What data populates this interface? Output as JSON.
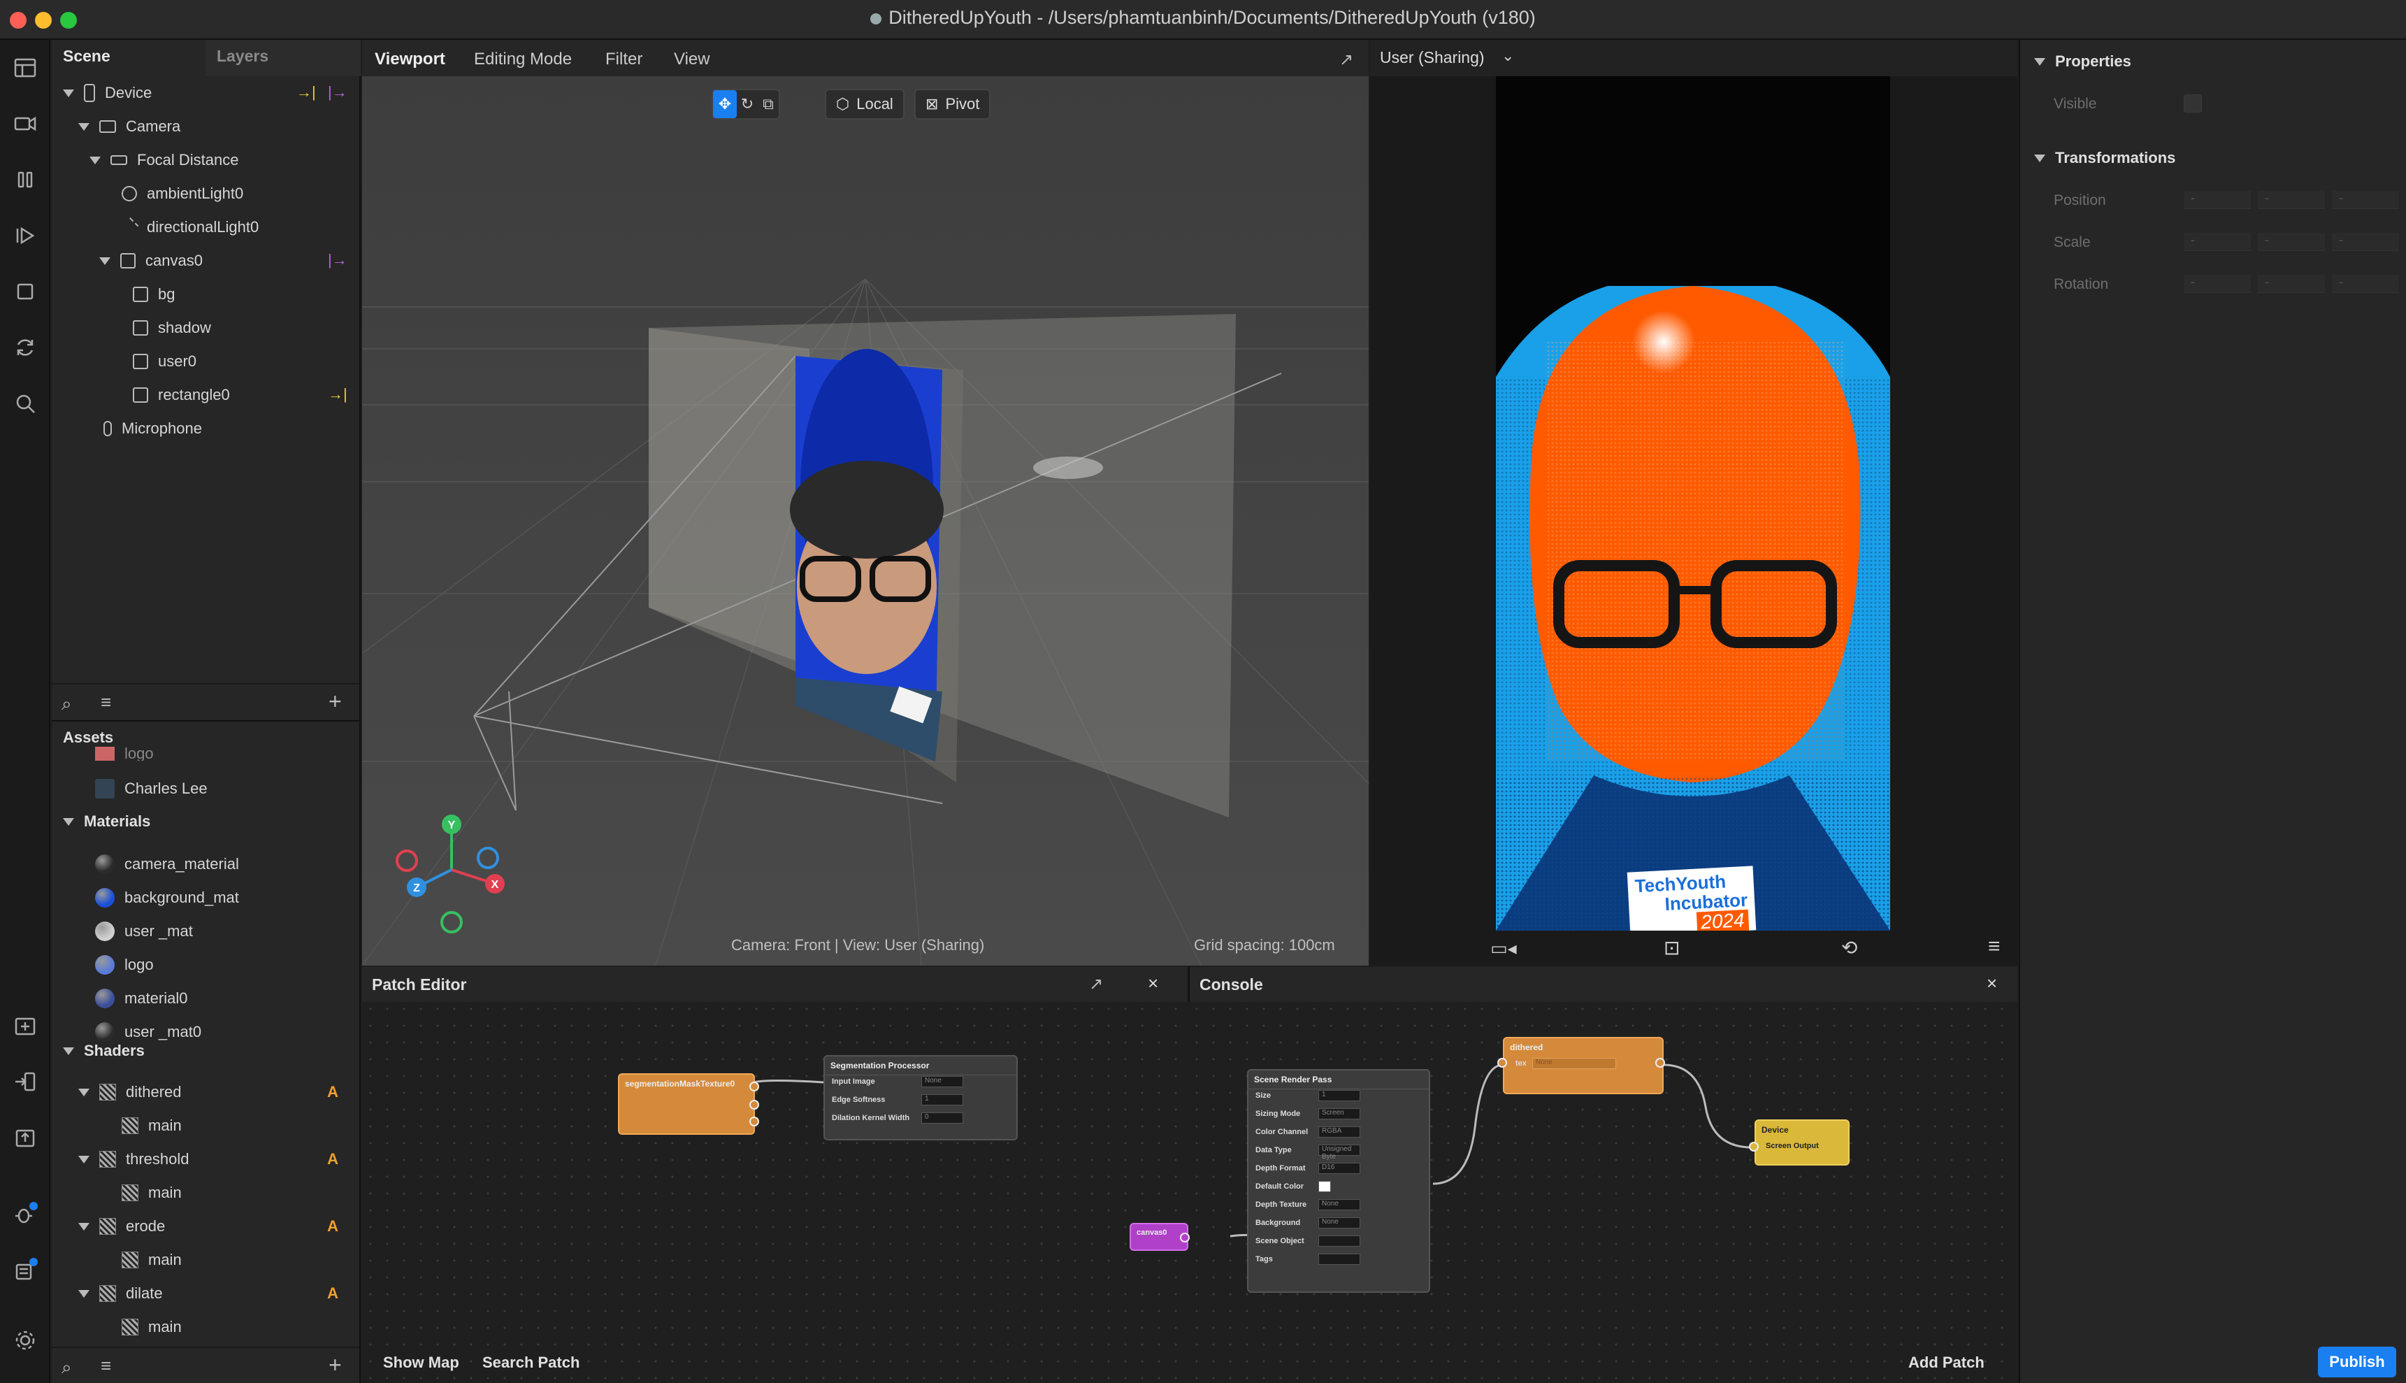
{
  "window": {
    "title": "DitheredUpYouth - /Users/phamtuanbinh/Documents/DitheredUpYouth (v180)"
  },
  "scene": {
    "tabs": [
      "Scene",
      "Layers"
    ],
    "tree": [
      {
        "label": "Device"
      },
      {
        "label": "Camera"
      },
      {
        "label": "Focal Distance"
      },
      {
        "label": "ambientLight0"
      },
      {
        "label": "directionalLight0"
      },
      {
        "label": "canvas0"
      },
      {
        "label": "bg"
      },
      {
        "label": "shadow"
      },
      {
        "label": "user0"
      },
      {
        "label": "rectangle0"
      },
      {
        "label": "Microphone"
      }
    ]
  },
  "assets": {
    "title": "Assets",
    "partial_item": "logo",
    "top_items": [
      {
        "label": "Charles Lee"
      }
    ],
    "materials_label": "Materials",
    "materials": [
      {
        "label": "camera_material",
        "color": "#2a2a2a"
      },
      {
        "label": "background_mat",
        "color": "#1a4fd8"
      },
      {
        "label": "user _mat",
        "color": "#cfcfcf"
      },
      {
        "label": "logo",
        "color": "#5b7bd8"
      },
      {
        "label": "material0",
        "color": "#3b4e9a"
      },
      {
        "label": "user _mat0",
        "color": "#2a2a2a"
      }
    ],
    "shaders_label": "Shaders",
    "shaders": [
      {
        "label": "dithered",
        "child": "main",
        "badge": "A"
      },
      {
        "label": "threshold",
        "child": "main",
        "badge": "A"
      },
      {
        "label": "erode",
        "child": "main",
        "badge": "A"
      },
      {
        "label": "dilate",
        "child": "main",
        "badge": "A"
      }
    ]
  },
  "viewport": {
    "menu": [
      "Viewport",
      "Editing Mode",
      "Filter",
      "View"
    ],
    "local_label": "Local",
    "pivot_label": "Pivot",
    "status_left": "Camera: Front | View: User (Sharing)",
    "status_right": "Grid spacing: 100cm",
    "gizmo": {
      "y": "Y",
      "x": "X",
      "z": "Z"
    }
  },
  "preview": {
    "device_label": "User (Sharing)",
    "badge_line1": "TechYouth",
    "badge_line2": "Incubator",
    "badge_year": "2024"
  },
  "properties": {
    "title": "Properties",
    "visible_label": "Visible",
    "transformations_label": "Transformations",
    "rows": [
      "Position",
      "Scale",
      "Rotation"
    ],
    "field_placeholder": "-"
  },
  "patch_editor": {
    "title": "Patch Editor",
    "show_map": "Show Map",
    "search_patch": "Search Patch",
    "add_patch": "Add Patch",
    "nodes": {
      "seg_mask": "segmentationMaskTexture0",
      "seg_proc": "Segmentation Processor",
      "seg_proc_rows": [
        "Input Image",
        "Edge Softness",
        "Dilation Kernel Width"
      ],
      "seg_proc_values": [
        "None",
        "1",
        "0"
      ],
      "srp": "Scene Render Pass",
      "srp_rows": [
        "Size",
        "Sizing Mode",
        "Color Channel",
        "Data Type",
        "Depth Format",
        "Default Color",
        "Depth Texture",
        "Background",
        "Scene Object",
        "Tags"
      ],
      "srp_values": [
        "1",
        "Screen",
        "RGBA",
        "Unsigned Byte",
        "D16",
        "",
        "None",
        "None",
        "",
        ""
      ],
      "dithered": "dithered",
      "dithered_port": "tex",
      "dithered_value": "None",
      "device": "Device",
      "screen_output": "Screen Output",
      "canvas": "canvas0"
    }
  },
  "console": {
    "title": "Console"
  },
  "publish_label": "Publish",
  "colors": {
    "accent": "#1a7ff0",
    "patch_orange": "#d48a3a",
    "patch_yellow": "#d9b83a",
    "patch_purple": "#b040c8",
    "dither_orange": "#ff5a00",
    "dither_blue": "#1aa0e8"
  }
}
